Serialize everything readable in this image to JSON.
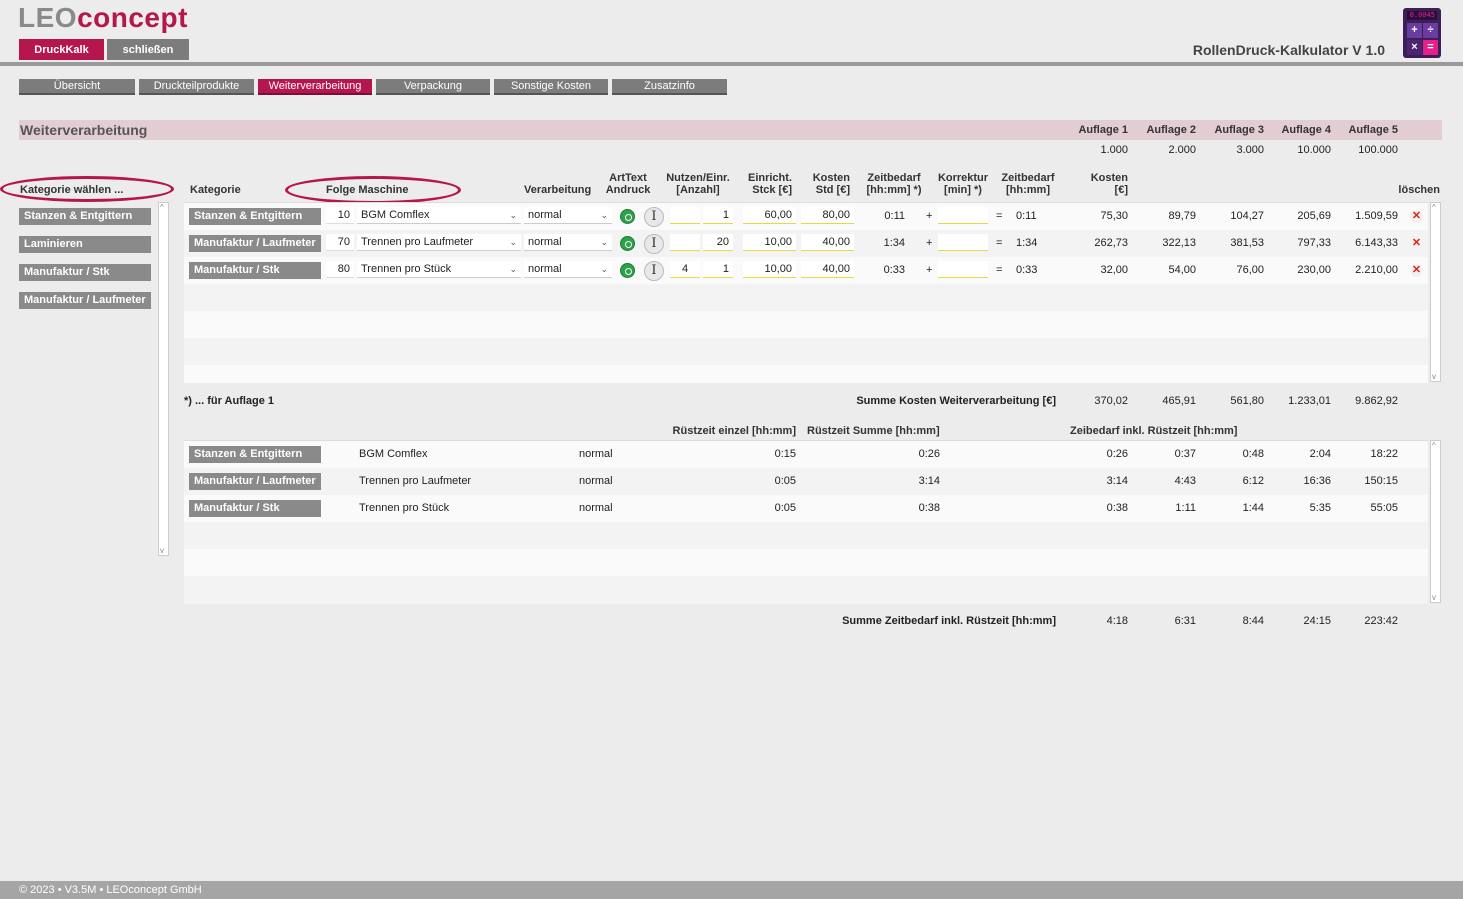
{
  "logo": {
    "leo": "LEO",
    "concept": "concept"
  },
  "top_buttons": {
    "druckkalk": "DruckKalk",
    "close": "schließen"
  },
  "app_title": "RollenDruck-Kalkulator V 1.0",
  "calculator_display": "0.0045",
  "calculator_keys": [
    "+",
    "÷",
    "×",
    "="
  ],
  "tabs": [
    "Übersicht",
    "Druckteilprodukte",
    "Weiterverarbeitung",
    "Verpackung",
    "Sonstige Kosten",
    "Zusatzinfo"
  ],
  "active_tab": "Weiterverarbeitung",
  "section_title": "Weiterverarbeitung",
  "auflagen": {
    "labels": [
      "Auflage 1",
      "Auflage 2",
      "Auflage 3",
      "Auflage 4",
      "Auflage 5"
    ],
    "values": [
      "1.000",
      "2.000",
      "3.000",
      "10.000",
      "100.000"
    ]
  },
  "left_panel": {
    "title": "Kategorie wählen ...",
    "items": [
      "Stanzen & Entgittern",
      "Laminieren",
      "Manufaktur / Stk",
      "Manufaktur / Laufmeter"
    ]
  },
  "table": {
    "headers": {
      "kategorie": "Kategorie",
      "folge_maschine": "Folge Maschine",
      "verarbeitung": "Verarbeitung",
      "arttext_1": "ArtText",
      "arttext_2": "Andruck",
      "nutzen_1": "Nutzen/Einr.",
      "nutzen_2": "[Anzahl]",
      "einricht_1": "Einricht.",
      "einricht_2": "Stck [€]",
      "kosten_std_1": "Kosten",
      "kosten_std_2": "Std [€]",
      "zeitbedarf_1": "Zeitbedarf",
      "zeitbedarf_2": "[hh:mm] *)",
      "korrektur_1": "Korrektur",
      "korrektur_2": "[min] *)",
      "zeitbedarf2_1": "Zeitbedarf",
      "zeitbedarf2_2": "[hh:mm]",
      "kosten_1": "Kosten",
      "kosten_2": "[€]",
      "loeschen": "löschen"
    },
    "rows": [
      {
        "kategorie": "Stanzen & Entgittern",
        "folge": "10",
        "maschine": "BGM Comflex",
        "verarbeitung": "normal",
        "nutzen_a": "",
        "nutzen_b": "1",
        "einricht": "60,00",
        "kosten_std": "80,00",
        "zeit": "0:11",
        "plus": "+",
        "korrektur": "",
        "eq": "=",
        "zeit_total": "0:11",
        "kosten": [
          "75,30",
          "89,79",
          "104,27",
          "205,69",
          "1.509,59"
        ]
      },
      {
        "kategorie": "Manufaktur / Laufmeter",
        "folge": "70",
        "maschine": "Trennen pro Laufmeter",
        "verarbeitung": "normal",
        "nutzen_a": "",
        "nutzen_b": "20",
        "einricht": "10,00",
        "kosten_std": "40,00",
        "zeit": "1:34",
        "plus": "+",
        "korrektur": "",
        "eq": "=",
        "zeit_total": "1:34",
        "kosten": [
          "262,73",
          "322,13",
          "381,53",
          "797,33",
          "6.143,33"
        ]
      },
      {
        "kategorie": "Manufaktur / Stk",
        "folge": "80",
        "maschine": "Trennen pro Stück",
        "verarbeitung": "normal",
        "nutzen_a": "4",
        "nutzen_b": "1",
        "einricht": "10,00",
        "kosten_std": "40,00",
        "zeit": "0:33",
        "plus": "+",
        "korrektur": "",
        "eq": "=",
        "zeit_total": "0:33",
        "kosten": [
          "32,00",
          "54,00",
          "76,00",
          "230,00",
          "2.210,00"
        ]
      }
    ],
    "footnote": "*) ... für Auflage 1",
    "sum_label": "Summe Kosten Weiterverarbeitung [€]",
    "sum_values": [
      "370,02",
      "465,91",
      "561,80",
      "1.233,01",
      "9.862,92"
    ]
  },
  "time_table": {
    "headers": {
      "ruest_einzel": "Rüstzeit einzel [hh:mm]",
      "ruest_summe": "Rüstzeit Summe [hh:mm]",
      "zeitbedarf": "Zeibedarf inkl. Rüstzeit [hh:mm]"
    },
    "rows": [
      {
        "kategorie": "Stanzen & Entgittern",
        "maschine": "BGM Comflex",
        "verarbeitung": "normal",
        "ruest_einzel": "0:15",
        "ruest_summe": "0:26",
        "zeiten": [
          "0:26",
          "0:37",
          "0:48",
          "2:04",
          "18:22"
        ]
      },
      {
        "kategorie": "Manufaktur / Laufmeter",
        "maschine": "Trennen pro Laufmeter",
        "verarbeitung": "normal",
        "ruest_einzel": "0:05",
        "ruest_summe": "3:14",
        "zeiten": [
          "3:14",
          "4:43",
          "6:12",
          "16:36",
          "150:15"
        ]
      },
      {
        "kategorie": "Manufaktur / Stk",
        "maschine": "Trennen pro Stück",
        "verarbeitung": "normal",
        "ruest_einzel": "0:05",
        "ruest_summe": "0:38",
        "zeiten": [
          "0:38",
          "1:11",
          "1:44",
          "5:35",
          "55:05"
        ]
      }
    ],
    "sum_label": "Summe Zeitbedarf inkl. Rüstzeit [hh:mm]",
    "sum_values": [
      "4:18",
      "6:31",
      "8:44",
      "24:15",
      "223:42"
    ]
  },
  "footer": "© 2023 • V3.5M • LEOconcept GmbH",
  "colors": {
    "accent": "#b5164d",
    "tab_gray": "#7c7c7c",
    "section_bar": "#e2cdd3"
  }
}
